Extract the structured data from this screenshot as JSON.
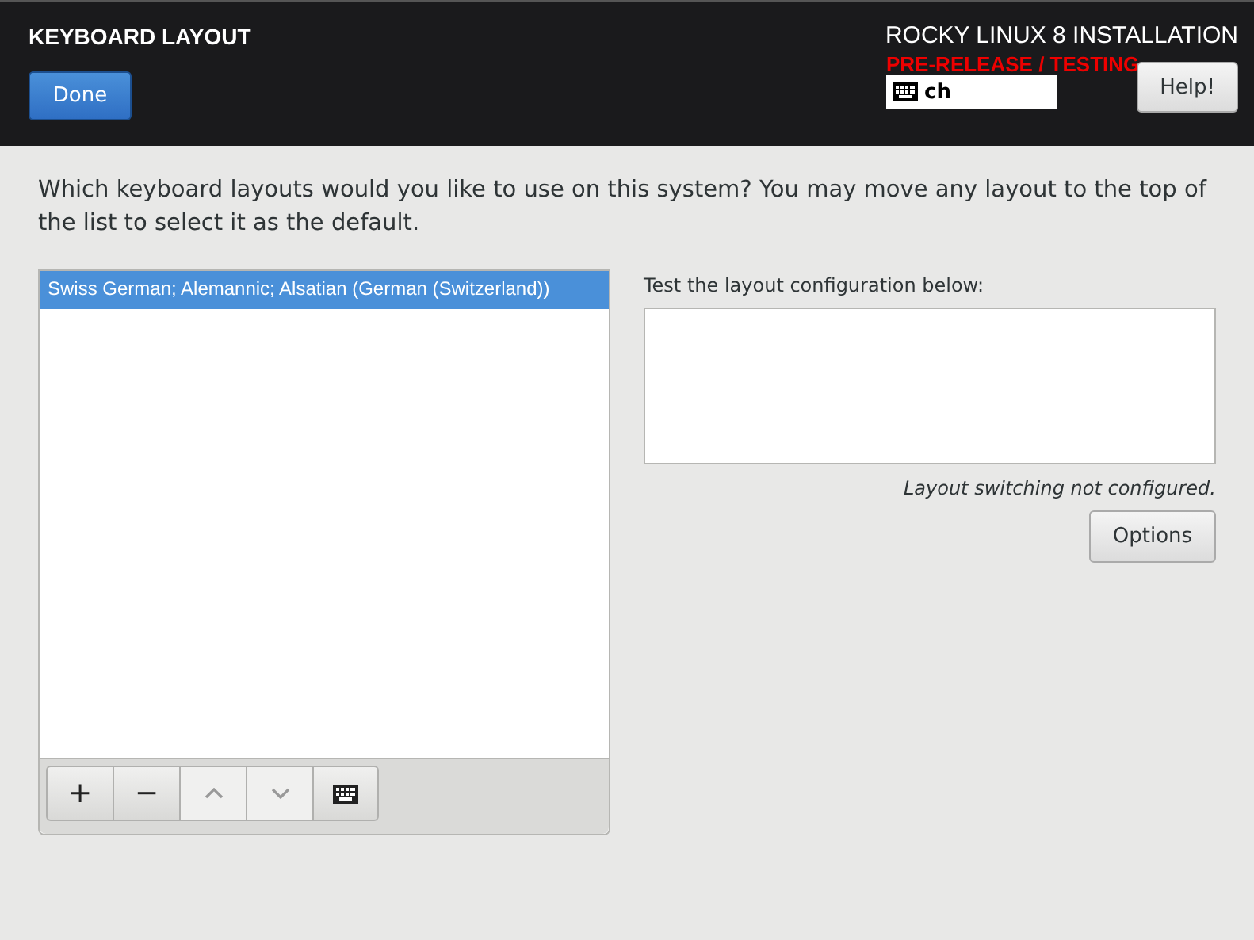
{
  "header": {
    "title": "KEYBOARD LAYOUT",
    "done_button": "Done",
    "product": "ROCKY LINUX 8 INSTALLATION",
    "prerelease": "PRE-RELEASE / TESTING",
    "layout_indicator": "ch",
    "help_button": "Help!"
  },
  "prompt": "Which keyboard layouts would you like to use on this system?  You may move any layout to the top of the list to select it as the default.",
  "layouts": [
    {
      "label": "Swiss German; Alemannic; Alsatian (German (Switzerland))",
      "selected": true
    }
  ],
  "toolbar": [
    {
      "kind": "add",
      "label": "+",
      "disabled": false
    },
    {
      "kind": "remove",
      "label": "−",
      "disabled": false
    },
    {
      "kind": "up",
      "disabled": true
    },
    {
      "kind": "down",
      "disabled": true
    },
    {
      "kind": "keyboard",
      "disabled": false
    }
  ],
  "test": {
    "label": "Test the layout configuration below:",
    "note": "Layout switching not configured.",
    "options_button": "Options"
  }
}
